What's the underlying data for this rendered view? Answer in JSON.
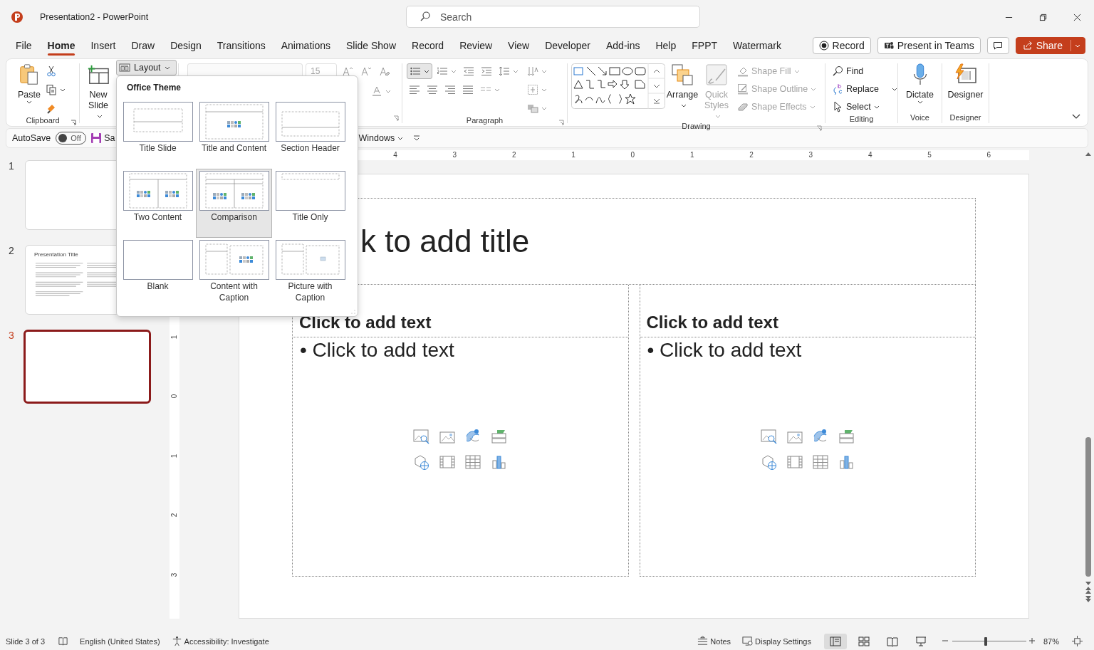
{
  "window": {
    "title": "Presentation2 - PowerPoint",
    "search": {
      "placeholder": "Search"
    }
  },
  "tabs": [
    {
      "label": "File",
      "selected": false
    },
    {
      "label": "Home",
      "selected": true
    },
    {
      "label": "Insert",
      "selected": false
    },
    {
      "label": "Draw",
      "selected": false
    },
    {
      "label": "Design",
      "selected": false
    },
    {
      "label": "Transitions",
      "selected": false
    },
    {
      "label": "Animations",
      "selected": false
    },
    {
      "label": "Slide Show",
      "selected": false
    },
    {
      "label": "Record",
      "selected": false
    },
    {
      "label": "Review",
      "selected": false
    },
    {
      "label": "View",
      "selected": false
    },
    {
      "label": "Developer",
      "selected": false
    },
    {
      "label": "Add-ins",
      "selected": false
    },
    {
      "label": "Help",
      "selected": false
    },
    {
      "label": "FPPT",
      "selected": false
    },
    {
      "label": "Watermark",
      "selected": false
    }
  ],
  "header_buttons": [
    {
      "kind": "record",
      "label": "Record"
    },
    {
      "kind": "teams",
      "label": "Present in Teams"
    },
    {
      "kind": "comments"
    },
    {
      "kind": "share",
      "label": "Share"
    }
  ],
  "ribbon": {
    "clipboard": {
      "label": "Clipboard",
      "paste": "Paste"
    },
    "slides": {
      "new_slide": "New Slide",
      "layout": {
        "label": "Layout",
        "expanded": true
      }
    },
    "font": {
      "size": "15",
      "disabled": true
    },
    "paragraph": {
      "label": "Paragraph"
    },
    "drawing": {
      "label": "Drawing",
      "buttons": [
        {
          "label": "Arrange",
          "disabled": false
        },
        {
          "label": "Quick Styles",
          "disabled": true
        }
      ],
      "format": [
        {
          "label": "Shape Fill",
          "disabled": true
        },
        {
          "label": "Shape Outline",
          "disabled": true
        },
        {
          "label": "Shape Effects",
          "disabled": true
        }
      ]
    },
    "editing": {
      "label": "Editing",
      "items": [
        {
          "kind": "find",
          "label": "Find"
        },
        {
          "kind": "replace",
          "label": "Replace"
        },
        {
          "kind": "select",
          "label": "Select"
        }
      ]
    },
    "voice": {
      "label": "Voice",
      "button": "Dictate"
    },
    "designer": {
      "label": "Designer",
      "button": "Designer"
    }
  },
  "quick_access": {
    "autosave": {
      "label": "AutoSave",
      "on": false,
      "state": "Off"
    },
    "save": "Sa",
    "windows": "Windows"
  },
  "layout_gallery": {
    "title": "Office Theme",
    "items": [
      {
        "kind": "title",
        "label": "Title Slide",
        "selected": false
      },
      {
        "kind": "title-content",
        "label": "Title and Content",
        "selected": false
      },
      {
        "kind": "section",
        "label": "Section Header",
        "selected": false
      },
      {
        "kind": "two-content",
        "label": "Two Content",
        "selected": false
      },
      {
        "kind": "comparison",
        "label": "Comparison",
        "selected": true
      },
      {
        "kind": "title-only",
        "label": "Title Only",
        "selected": false
      },
      {
        "kind": "blank",
        "label": "Blank",
        "selected": false
      },
      {
        "kind": "content-caption",
        "label": "Content with Caption",
        "selected": false
      },
      {
        "kind": "picture-caption",
        "label": "Picture with Caption",
        "selected": false
      }
    ]
  },
  "slides_panel": [
    {
      "number": "1",
      "selected": false
    },
    {
      "number": "2",
      "selected": false,
      "title": "Presentation Title"
    },
    {
      "number": "3",
      "selected": true
    }
  ],
  "ruler": {
    "horizontal": [
      "4",
      "3",
      "2",
      "1",
      "0",
      "1",
      "2",
      "3",
      "4",
      "5",
      "6"
    ],
    "vertical": [
      "1",
      "0",
      "1",
      "2",
      "3"
    ]
  },
  "slide": {
    "title": "k to add title",
    "columns": [
      {
        "heading": "Click to add text",
        "body": "• Click to add text"
      },
      {
        "heading": "Click to add text",
        "body": "• Click to add text"
      }
    ]
  },
  "status_bar": {
    "slide": "Slide 3 of 3",
    "language": "English (United States)",
    "accessibility": "Accessibility: Investigate",
    "notes": "Notes",
    "display": "Display Settings",
    "views": [
      {
        "kind": "normal",
        "selected": true
      },
      {
        "kind": "sorter",
        "selected": false
      },
      {
        "kind": "reading",
        "selected": false
      },
      {
        "kind": "show",
        "selected": false
      }
    ],
    "zoom": {
      "level": 0.45,
      "reading": "87%"
    }
  }
}
